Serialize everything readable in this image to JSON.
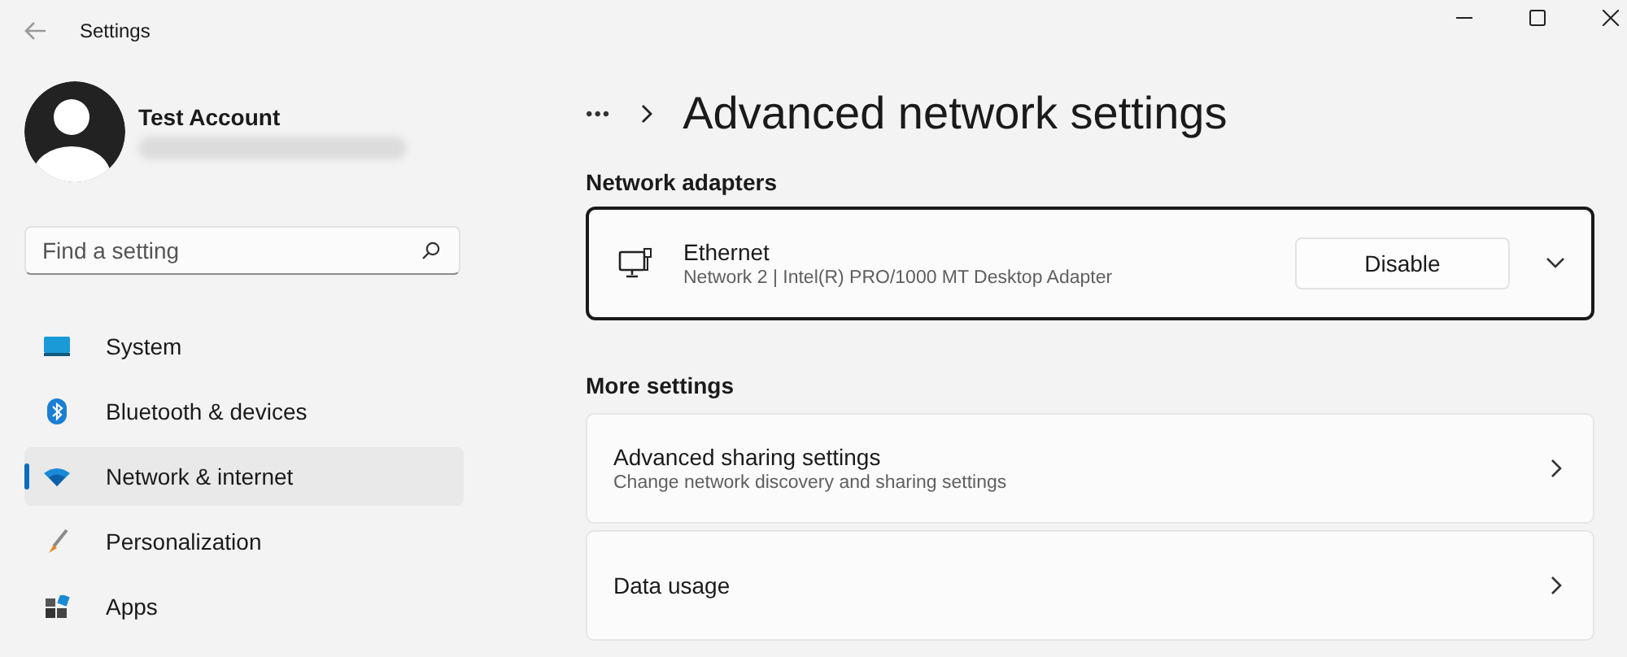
{
  "window": {
    "title": "Settings"
  },
  "account": {
    "name": "Test Account"
  },
  "search": {
    "placeholder": "Find a setting"
  },
  "sidebar": {
    "items": [
      {
        "label": "System",
        "kind": "system",
        "selected": false
      },
      {
        "label": "Bluetooth & devices",
        "kind": "bluetooth",
        "selected": false
      },
      {
        "label": "Network & internet",
        "kind": "network",
        "selected": true
      },
      {
        "label": "Personalization",
        "kind": "brush",
        "selected": false
      },
      {
        "label": "Apps",
        "kind": "apps",
        "selected": false
      }
    ]
  },
  "breadcrumb": {
    "more": "•••",
    "title": "Advanced network settings"
  },
  "adapters": {
    "heading": "Network adapters",
    "items": [
      {
        "name": "Ethernet",
        "detail": "Network 2 | Intel(R) PRO/1000 MT Desktop Adapter",
        "button": "Disable",
        "expanded": false
      }
    ]
  },
  "more_settings": {
    "heading": "More settings",
    "items": [
      {
        "title": "Advanced sharing settings",
        "subtitle": "Change network discovery and sharing settings"
      },
      {
        "title": "Data usage"
      }
    ]
  }
}
